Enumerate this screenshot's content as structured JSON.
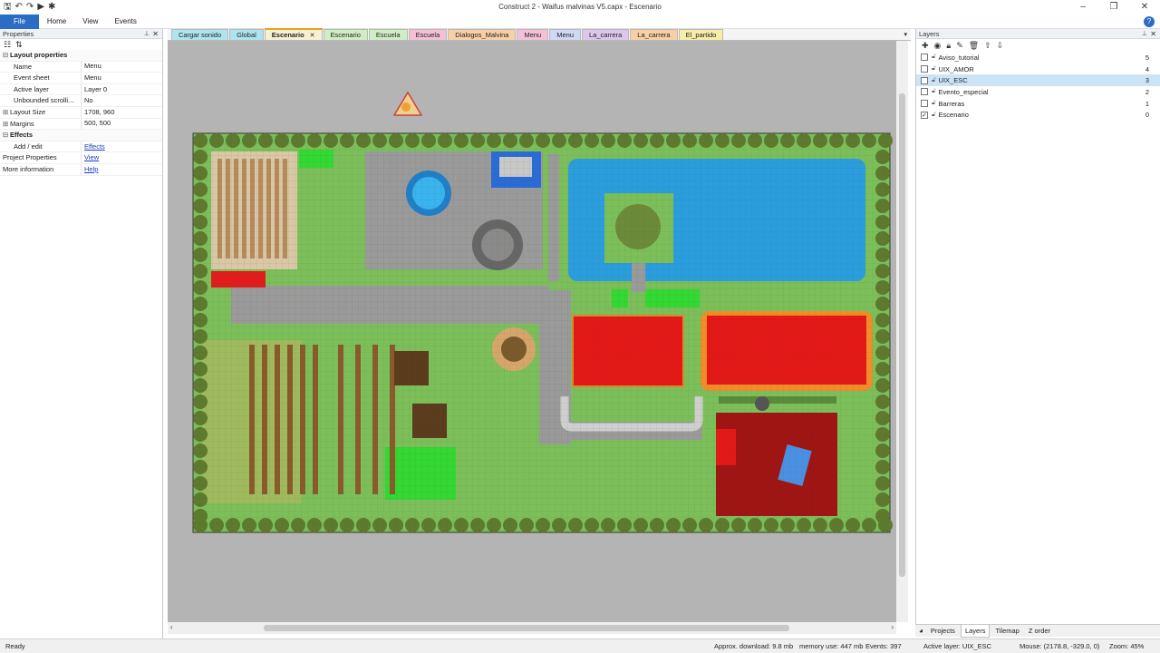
{
  "window": {
    "title": "Construct 2 - Waifus malvinas V5.capx - Escenario"
  },
  "ribbon": {
    "tabs": [
      "File",
      "Home",
      "View",
      "Events"
    ]
  },
  "properties": {
    "title": "Properties",
    "rows": [
      {
        "type": "cat",
        "label": "Layout properties"
      },
      {
        "type": "prop",
        "key": "Name",
        "value": "Menu"
      },
      {
        "type": "prop",
        "key": "Event sheet",
        "value": "Menu"
      },
      {
        "type": "prop",
        "key": "Active layer",
        "value": "Layer 0"
      },
      {
        "type": "prop",
        "key": "Unbounded scrolli...",
        "value": "No"
      },
      {
        "type": "exp",
        "key": "Layout Size",
        "value": "1708, 960"
      },
      {
        "type": "exp",
        "key": "Margins",
        "value": "500, 500"
      },
      {
        "type": "cat",
        "label": "Effects"
      },
      {
        "type": "link",
        "key": "Add / edit",
        "value": "Effects"
      },
      {
        "type": "linktop",
        "key": "Project Properties",
        "value": "View"
      },
      {
        "type": "linktop",
        "key": "More information",
        "value": "Help"
      }
    ]
  },
  "tabs": [
    {
      "label": "Cargar sonido",
      "color": "#aee3f0"
    },
    {
      "label": "Global",
      "color": "#aee3f0"
    },
    {
      "label": "Escenario",
      "color": "#f6e3a6",
      "active": true,
      "close": "✕"
    },
    {
      "label": "Escenario",
      "color": "#cfeec4"
    },
    {
      "label": "Escuela",
      "color": "#cfeec4"
    },
    {
      "label": "Escuela",
      "color": "#f4c0d8"
    },
    {
      "label": "Dialogos_Malvina",
      "color": "#f9cfa6"
    },
    {
      "label": "Menu",
      "color": "#f4c0d8"
    },
    {
      "label": "Menu",
      "color": "#cfd8f4"
    },
    {
      "label": "La_carrera",
      "color": "#dcc6ee"
    },
    {
      "label": "La_carrera",
      "color": "#f9cfa6"
    },
    {
      "label": "El_partido",
      "color": "#f6eea6"
    }
  ],
  "layers": {
    "title": "Layers",
    "items": [
      {
        "name": "Aviso_tutorial",
        "num": "5",
        "checked": false,
        "selected": false
      },
      {
        "name": "UIX_AMOR",
        "num": "4",
        "checked": false,
        "selected": false
      },
      {
        "name": "UIX_ESC",
        "num": "3",
        "checked": false,
        "selected": true
      },
      {
        "name": "Evento_especial",
        "num": "2",
        "checked": false,
        "selected": false
      },
      {
        "name": "Barreras",
        "num": "1",
        "checked": false,
        "selected": false
      },
      {
        "name": "Escenario",
        "num": "0",
        "checked": true,
        "selected": false
      }
    ]
  },
  "bottom_tabs": [
    {
      "label": "Projects",
      "active": false
    },
    {
      "label": "Layers",
      "active": true
    },
    {
      "label": "Tilemap",
      "active": false
    },
    {
      "label": "Z order",
      "active": false
    }
  ],
  "status": {
    "ready": "Ready",
    "download": "Approx. download: 9.8 mb",
    "memory": "memory use: 447 mb",
    "events": "Events: 397",
    "active_layer": "Active layer: UIX_ESC",
    "mouse": "Mouse: (2178.8, -329.0, 0)",
    "zoom": "Zoom: 45%"
  }
}
